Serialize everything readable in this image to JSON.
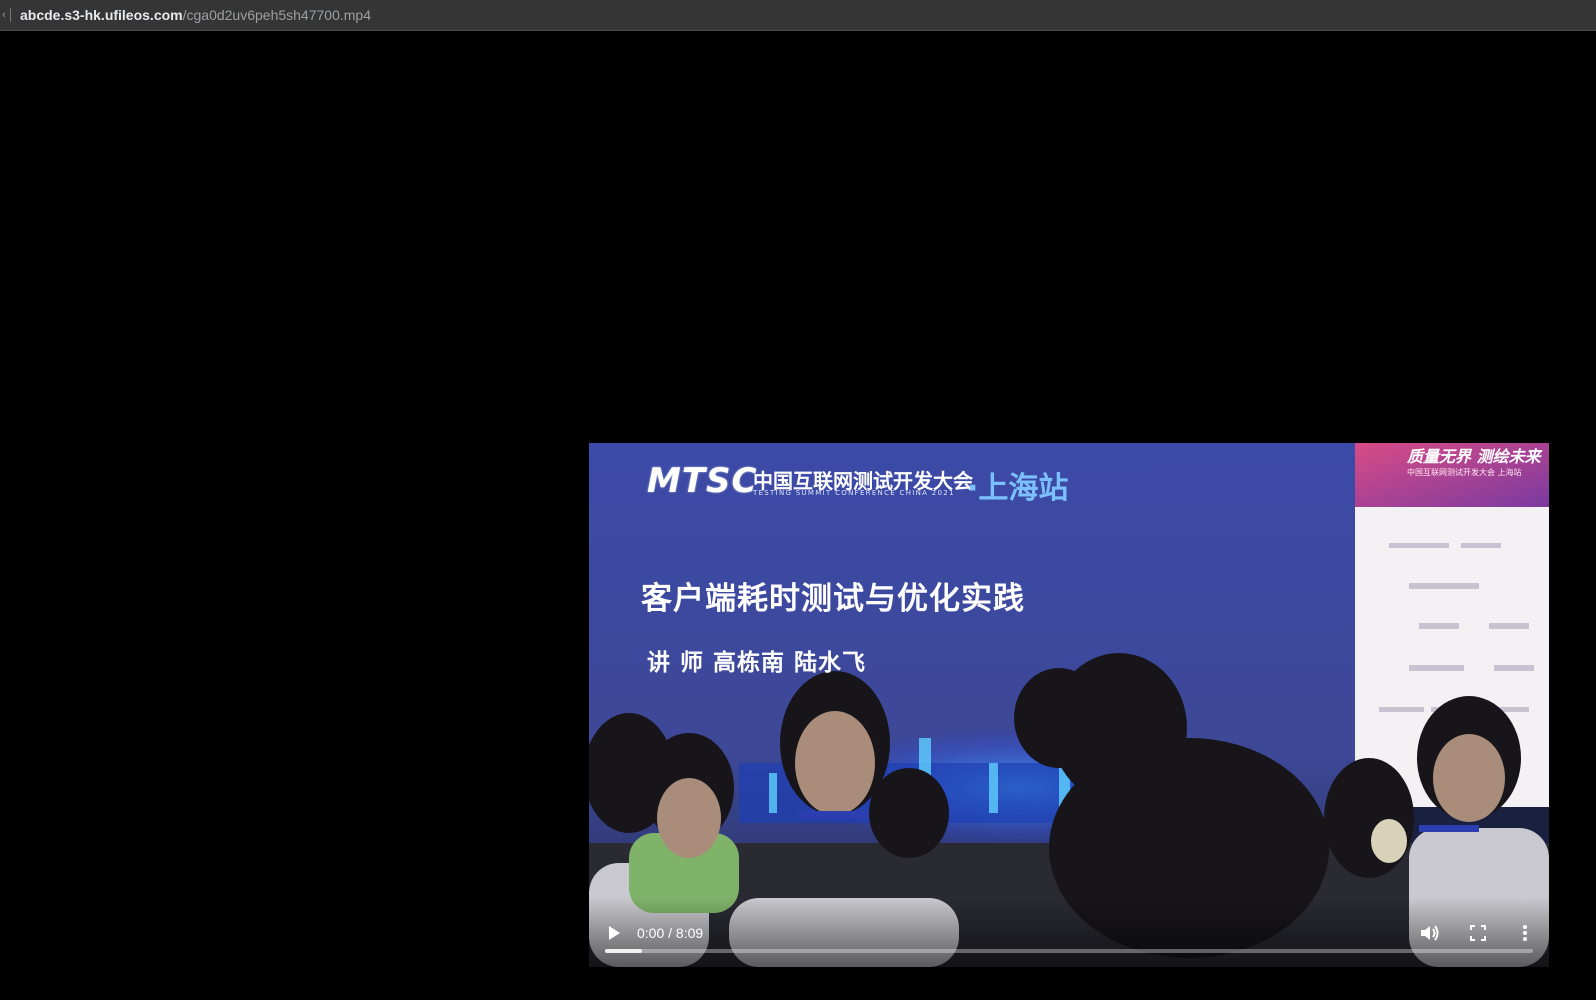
{
  "address_bar": {
    "edge_glyph": "‹",
    "host": "abcde.s3-hk.ufileos.com",
    "path": "/cga0d2uv6peh5sh47700.mp4"
  },
  "video": {
    "frame": {
      "brand": "MTSC",
      "conference_cn": "中国互联网测试开发大会",
      "conference_en": "TESTING SUMMIT CONFERENCE CHINA 2021",
      "city": "·上海站",
      "talk_title": "客户端耗时测试与优化实践",
      "speakers": "讲 师  高栋南   陆水飞",
      "banner_slogan": "质量无界 测绘未来",
      "banner_sub": "中国互联网测试开发大会 上海站"
    },
    "controls": {
      "play_icon": "play-icon",
      "time": "0:00 / 8:09",
      "volume_icon": "volume-icon",
      "fullscreen_icon": "fullscreen-icon",
      "more_icon": "more-vertical-icon",
      "buffered_fraction": 0.04
    }
  }
}
